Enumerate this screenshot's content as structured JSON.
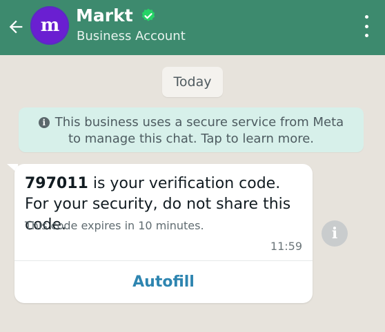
{
  "header": {
    "title": "Markt",
    "subtitle": "Business Account",
    "avatar_text": "m",
    "colors": {
      "bar": "#3d8a6e",
      "avatar": "#6a1fd1",
      "verified": "#25d366"
    },
    "icons": {
      "back": "arrow-left-icon",
      "verified": "verified-badge-icon",
      "menu": "more-vertical-icon"
    }
  },
  "chat": {
    "date_label": "Today",
    "info_banner": {
      "line1": "This business uses a secure service from Meta",
      "line2": "to manage this chat. Tap to learn more.",
      "icon": "info-icon"
    },
    "message": {
      "code": "797011",
      "text_after_code": " is your verification code. For your security, do not share this code.",
      "expiry": "This code expires in 10 minutes.",
      "time": "11:59",
      "button_label": "Autofill"
    },
    "side_icon": "info-icon"
  }
}
